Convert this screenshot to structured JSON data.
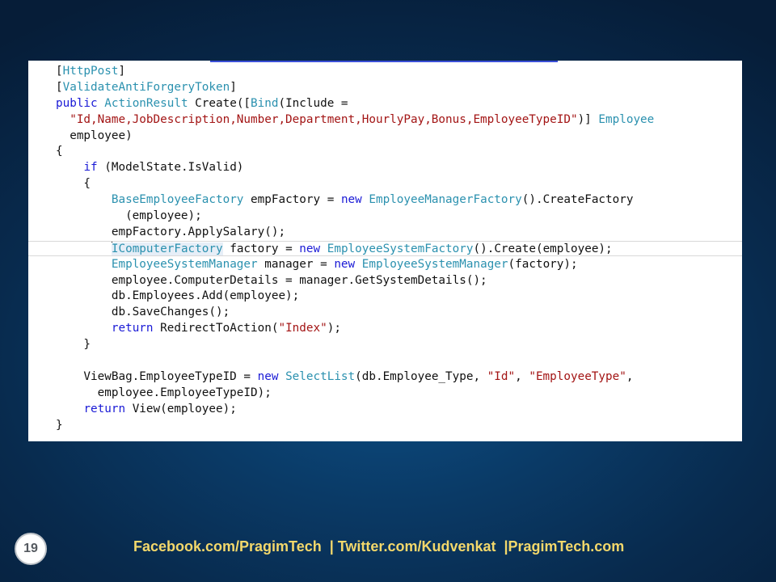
{
  "code": {
    "lines": [
      [
        {
          "t": "["
        },
        {
          "t": "HttpPost",
          "c": "ty"
        },
        {
          "t": "]"
        }
      ],
      [
        {
          "t": "["
        },
        {
          "t": "ValidateAntiForgeryToken",
          "c": "ty"
        },
        {
          "t": "]"
        }
      ],
      [
        {
          "t": "public",
          "c": "kw"
        },
        {
          "t": " "
        },
        {
          "t": "ActionResult",
          "c": "ty"
        },
        {
          "t": " Create(["
        },
        {
          "t": "Bind",
          "c": "ty"
        },
        {
          "t": "(Include ="
        }
      ],
      [
        {
          "t": "  "
        },
        {
          "t": "\"Id,Name,JobDescription,Number,Department,HourlyPay,Bonus,EmployeeTypeID\"",
          "c": "st"
        },
        {
          "t": ")] "
        },
        {
          "t": "Employee",
          "c": "ty"
        }
      ],
      [
        {
          "t": "  employee)"
        }
      ],
      [
        {
          "t": "{"
        }
      ],
      [
        {
          "t": "    "
        },
        {
          "t": "if",
          "c": "kw"
        },
        {
          "t": " (ModelState.IsValid)"
        }
      ],
      [
        {
          "t": "    {"
        }
      ],
      [
        {
          "t": "        "
        },
        {
          "t": "BaseEmployeeFactory",
          "c": "ty"
        },
        {
          "t": " empFactory = "
        },
        {
          "t": "new",
          "c": "kw"
        },
        {
          "t": " "
        },
        {
          "t": "EmployeeManagerFactory",
          "c": "ty"
        },
        {
          "t": "().CreateFactory"
        }
      ],
      [
        {
          "t": "          (employee);"
        }
      ],
      [
        {
          "t": "        empFactory.ApplySalary();"
        }
      ],
      [
        {
          "t": "        "
        },
        {
          "t": "",
          "c": "caret"
        },
        {
          "t": "IComputerFactory",
          "c": "ty hl"
        },
        {
          "t": " factory = "
        },
        {
          "t": "new",
          "c": "kw"
        },
        {
          "t": " "
        },
        {
          "t": "EmployeeSystemFactory",
          "c": "ty"
        },
        {
          "t": "().Create(employee);"
        }
      ],
      [
        {
          "t": "        "
        },
        {
          "t": "EmployeeSystemManager",
          "c": "ty"
        },
        {
          "t": " manager = "
        },
        {
          "t": "new",
          "c": "kw"
        },
        {
          "t": " "
        },
        {
          "t": "EmployeeSystemManager",
          "c": "ty"
        },
        {
          "t": "(factory);"
        }
      ],
      [
        {
          "t": "        employee.ComputerDetails = manager.GetSystemDetails();"
        }
      ],
      [
        {
          "t": "        db.Employees.Add(employee);"
        }
      ],
      [
        {
          "t": "        db.SaveChanges();"
        }
      ],
      [
        {
          "t": "        "
        },
        {
          "t": "return",
          "c": "kw"
        },
        {
          "t": " RedirectToAction("
        },
        {
          "t": "\"Index\"",
          "c": "st"
        },
        {
          "t": ");"
        }
      ],
      [
        {
          "t": "    }"
        }
      ],
      [
        {
          "t": ""
        }
      ],
      [
        {
          "t": "    ViewBag.EmployeeTypeID = "
        },
        {
          "t": "new",
          "c": "kw"
        },
        {
          "t": " "
        },
        {
          "t": "SelectList",
          "c": "ty"
        },
        {
          "t": "(db.Employee_Type, "
        },
        {
          "t": "\"Id\"",
          "c": "st"
        },
        {
          "t": ", "
        },
        {
          "t": "\"EmployeeType\"",
          "c": "st"
        },
        {
          "t": ","
        }
      ],
      [
        {
          "t": "      employee.EmployeeTypeID);"
        }
      ],
      [
        {
          "t": "    "
        },
        {
          "t": "return",
          "c": "kw"
        },
        {
          "t": " View(employee);"
        }
      ],
      [
        {
          "t": "}"
        }
      ]
    ],
    "cursor_line": 11
  },
  "footer": {
    "slide_number": "19",
    "links": "Facebook.com/PragimTech  | Twitter.com/Kudvenkat  |PragimTech.com"
  },
  "colors": {
    "keyword": "#1a1ad6",
    "type": "#2b91af",
    "string": "#a31515",
    "footer_text": "#f3d86b"
  }
}
